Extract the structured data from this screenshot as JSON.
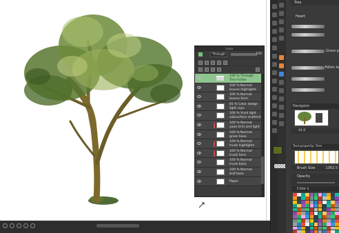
{
  "colors": {
    "selected_layer": "#8fc48f",
    "panel_bg": "#3a3a3a",
    "active_tool": "#e8843a",
    "accent_blue": "#3f86d6",
    "main_color": "#5a6b22"
  },
  "layer_panel": {
    "title": "Layer",
    "blend_mode": "Through",
    "opacity": "100",
    "layers": [
      {
        "mode": "100 % Through",
        "name": "Tree Folder",
        "selected": true,
        "type": "folder"
      },
      {
        "mode": "100 % Normal",
        "name": "leaves highlights"
      },
      {
        "mode": "100 % Normal",
        "name": "leaves form"
      },
      {
        "mode": "81 % Color dodge",
        "name": "light rays"
      },
      {
        "mode": "100 % Vivid light",
        "name": "subsurface scattering"
      },
      {
        "mode": "100 % Normal",
        "name": "yooo trim and light"
      },
      {
        "mode": "100 % Normal",
        "name": "grass base"
      },
      {
        "mode": "100 % Normal",
        "name": "trunk highlights"
      },
      {
        "mode": "100 % Normal",
        "name": "trunk form"
      },
      {
        "mode": "100 % Normal",
        "name": "trunk base"
      },
      {
        "mode": "100 % Normal",
        "name": "leaf base"
      },
      {
        "mode": "",
        "name": "Paper"
      }
    ]
  },
  "right_panel": {
    "tabs": [
      "Tree",
      "Heart"
    ],
    "brushes": [
      {
        "label": "Grass p"
      },
      {
        "label": "Fallen le"
      },
      {
        "label": ""
      },
      {
        "label": ""
      }
    ],
    "navigator": {
      "title": "Navigator",
      "zoom": "41.6"
    },
    "tool_property": {
      "title": "Tool property: Tree"
    },
    "brush_size": {
      "label": "Brush Size",
      "value": "1362.5"
    },
    "opacity": {
      "label": "Opacity"
    },
    "color_set_title": "Color s"
  }
}
